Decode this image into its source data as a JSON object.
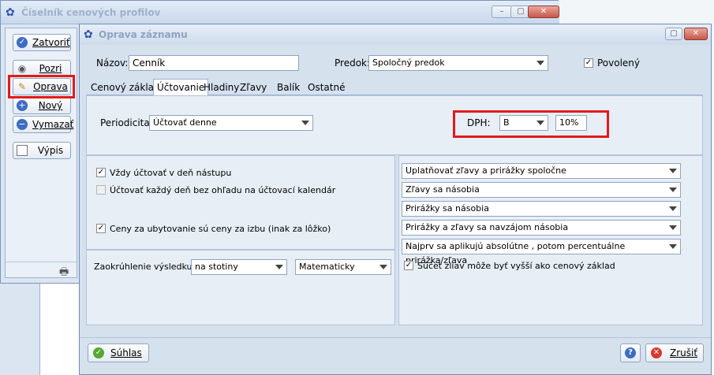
{
  "back_window": {
    "title": "Číselník cenových profilov",
    "sidebar": [
      {
        "label": "Zatvoriť",
        "icon": "check-circle-icon"
      },
      {
        "label": "Pozri",
        "icon": "eye-icon"
      },
      {
        "label": "Oprava",
        "icon": "pencil-icon"
      },
      {
        "label": "Nový",
        "icon": "plus-circle-icon"
      },
      {
        "label": "Vymazať",
        "icon": "minus-circle-icon"
      },
      {
        "label": "Výpis",
        "icon": "document-icon"
      }
    ]
  },
  "dialog": {
    "title": "Oprava záznamu",
    "name_label": "Názov:",
    "name_value": "Cenník",
    "parent_label": "Predok:",
    "parent_value": "Spoločný predok",
    "enabled_label": "Povolený",
    "tabs": [
      "Cenový základ",
      "Účtovanie",
      "Hladiny",
      "Zľavy",
      "Balík",
      "Ostatné"
    ],
    "periodicity_label": "Periodicita:",
    "periodicity_value": "Účtovať denne",
    "vat_label": "DPH:",
    "vat_value": "B",
    "vat_rate": "10%",
    "left_options": [
      {
        "label": "Vždy účtovať v deň nástupu",
        "checked": true,
        "disabled": false
      },
      {
        "label": "Účtovať každý deň bez ohľadu na účtovací kalendár",
        "checked": false,
        "disabled": true
      },
      {
        "label": "Ceny za ubytovanie sú ceny za izbu (inak za lôžko)",
        "checked": true,
        "disabled": false
      }
    ],
    "rounding_label": "Zaokrúhlenie výsledku:",
    "rounding_value": "na stotiny",
    "rounding_method": "Matematicky",
    "right_combos": [
      "Uplatňovať zľavy a prirážky spoločne",
      "Zľavy sa násobia",
      "Prirážky sa násobia",
      "Prirážky a zľavy sa navzájom násobia",
      "Najprv sa aplikujú absolútne , potom percentuálne prirážka/zľava"
    ],
    "sum_check_label": "Súčet zliav môže byť vyšší ako cenový základ",
    "agree_label": "Súhlas",
    "cancel_label": "Zrušiť",
    "help_label": "?"
  },
  "colors": {
    "highlight": "#e01b1b",
    "accent": "#6f8db5"
  }
}
